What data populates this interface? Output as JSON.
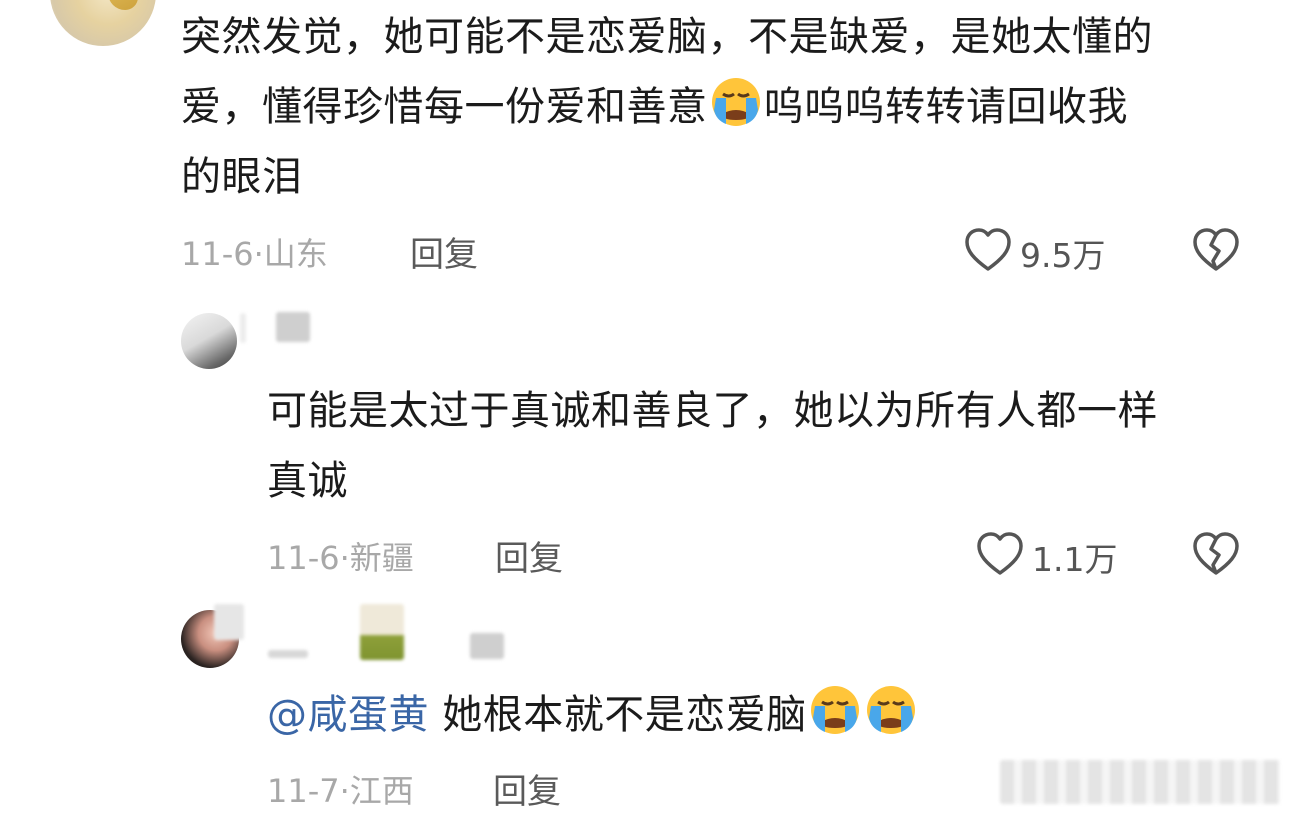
{
  "comments": [
    {
      "text_before_emoji": "突然发觉，她可能不是恋爱脑，不是缺爱，是她太懂的爱，懂得珍惜每一份爱和善意",
      "line1": "突然发觉，她可能不是恋爱脑，不是缺爱，是她太懂的",
      "line2_a": "爱，懂得珍惜每一份爱和善意",
      "line2_b": "呜呜呜转转请回收我",
      "line3": "的眼泪",
      "date": "11-6",
      "location": "山东",
      "reply_label": "回复",
      "likes": "9.5万"
    },
    {
      "line1": "可能是太过于真诚和善良了，她以为所有人都一样",
      "line2": "真诚",
      "date": "11-6",
      "location": "新疆",
      "reply_label": "回复",
      "likes": "1.1万"
    },
    {
      "mention": "@咸蛋黄",
      "text": "她根本就不是恋爱脑",
      "date": "11-7",
      "location": "江西",
      "reply_label": "回复"
    }
  ],
  "icons": {
    "like": "heart-outline-icon",
    "dislike": "broken-heart-icon",
    "emoji": "loudly-crying-face-emoji"
  },
  "colors": {
    "mention": "#3a66a6",
    "meta": "#a8a8a8",
    "text": "#1b1b1b"
  }
}
